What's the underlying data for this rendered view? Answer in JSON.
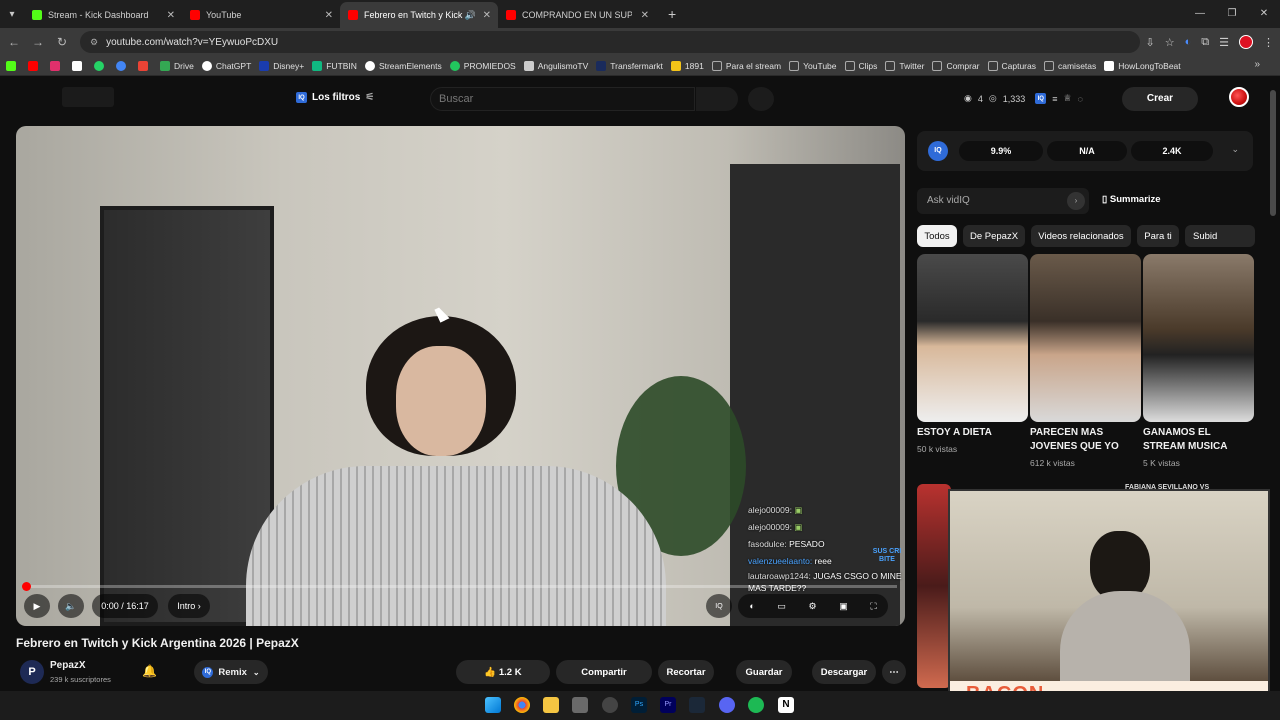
{
  "browser": {
    "tabs": [
      {
        "title": "Stream - Kick Dashboard",
        "favicon_color": "#53fc18",
        "active": false
      },
      {
        "title": "YouTube",
        "favicon_color": "#ff0000",
        "active": false
      },
      {
        "title": "Febrero en Twitch y Kick Ar",
        "favicon_color": "#ff0000",
        "active": true
      },
      {
        "title": "COMPRANDO EN UN SUPERM",
        "favicon_color": "#ff0000",
        "active": false
      }
    ],
    "new_tab_icon": "plus-icon",
    "url": "youtube.com/watch?v=YEywuoPcDXU",
    "bookmarks": [
      {
        "label": "",
        "icon_color": "#53fc18"
      },
      {
        "label": "",
        "icon_color": "#ff0000"
      },
      {
        "label": "",
        "icon_color": "#e1306c"
      },
      {
        "label": "",
        "icon_color": "#ffffff"
      },
      {
        "label": "",
        "icon_color": "#25d366"
      },
      {
        "label": "",
        "icon_color": "#4285f4"
      },
      {
        "label": "",
        "icon_color": "#ea4335"
      },
      {
        "label": "Drive",
        "icon_color": "#34a853"
      },
      {
        "label": "ChatGPT",
        "icon_color": "#ffffff"
      },
      {
        "label": "Disney+",
        "icon_color": "#1a3cae"
      },
      {
        "label": "FUTBIN",
        "icon_color": "#10b981"
      },
      {
        "label": "StreamElements",
        "icon_color": "#ffffff"
      },
      {
        "label": "PROMIEDOS",
        "icon_color": "#22c55e"
      },
      {
        "label": "AngulismoTV",
        "icon_color": "#cccccc"
      },
      {
        "label": "Transfermarkt",
        "icon_color": "#1a2b5c"
      },
      {
        "label": "1891",
        "icon_color": "#f5c518"
      },
      {
        "label": "Para el stream",
        "icon_color": "#aaaaaa"
      },
      {
        "label": "YouTube",
        "icon_color": "#aaaaaa"
      },
      {
        "label": "Clips",
        "icon_color": "#aaaaaa"
      },
      {
        "label": "Twitter",
        "icon_color": "#aaaaaa"
      },
      {
        "label": "Comprar",
        "icon_color": "#aaaaaa"
      },
      {
        "label": "Capturas",
        "icon_color": "#aaaaaa"
      },
      {
        "label": "camisetas",
        "icon_color": "#aaaaaa"
      },
      {
        "label": "HowLongToBeat",
        "icon_color": "#ffffff"
      }
    ]
  },
  "youtube": {
    "filters_label": "Los filtros",
    "search_placeholder": "Buscar",
    "header_stat_eye": "4",
    "header_stat_views": "1,333",
    "create_label": "Crear",
    "video": {
      "time": "0:00 / 16:17",
      "chapter": "Intro",
      "title": "Febrero en Twitch y Kick Argentina 2026 | PepazX",
      "channel": "PepazX",
      "channel_initial": "P",
      "subscribers": "239 k suscriptores",
      "remix_label": "Remix",
      "likes": "1.2 K",
      "share_label": "Compartir",
      "clip_label": "Recortar",
      "save_label": "Guardar",
      "download_label": "Descargar"
    },
    "overlay_chat": [
      {
        "user": "alejo00009:",
        "msg": "",
        "highlight": false
      },
      {
        "user": "alejo00009:",
        "msg": "",
        "highlight": false
      },
      {
        "user": "fasodulce:",
        "msg": "PESADO",
        "highlight": false
      },
      {
        "user": "valenzueelaanto:",
        "msg": "reee",
        "highlight": true
      },
      {
        "user": "lautaroawp1244:",
        "msg": "JUGAS CSGO O MINE MAS TARDE??",
        "highlight": false
      }
    ],
    "overlay_subscribe": "SUS CRI BITE",
    "vidiq": {
      "logo": "IQ",
      "stats": [
        "9.9%",
        "N/A",
        "2.4K"
      ],
      "ask_placeholder": "Ask vidIQ",
      "summarize_label": "Summarize"
    },
    "chips": [
      "Todos",
      "De PepazX",
      "Videos relacionados",
      "Para ti",
      "Subid"
    ],
    "shorts": [
      {
        "title": "ESTOY A DIETA",
        "views": "50 k vistas"
      },
      {
        "title": "PARECEN MAS JOVENES QUE YO",
        "views": "612 k vistas"
      },
      {
        "title": "GANAMOS EL STREAM MUSICA",
        "views": "5 K vistas"
      }
    ],
    "related_title_fragment": "FABIANA SEVILLANO VS",
    "webcam_banner": "BACON"
  }
}
